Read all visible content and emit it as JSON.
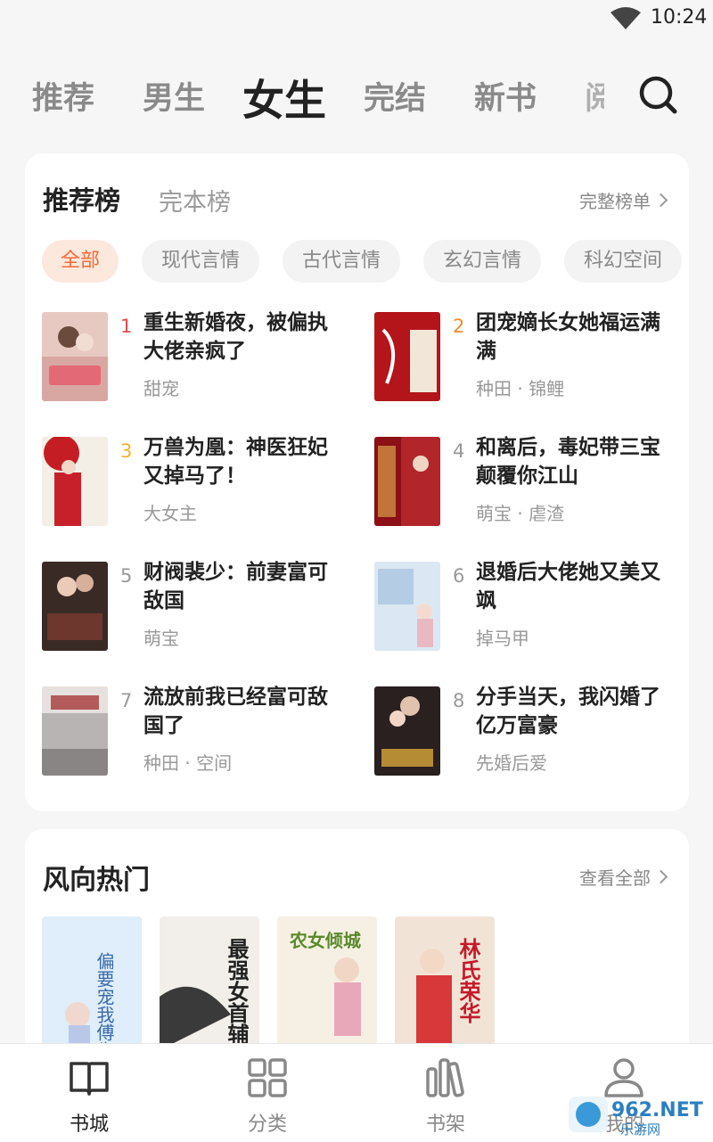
{
  "status": {
    "time": "10:24"
  },
  "top_tabs": [
    "推荐",
    "男生",
    "女生",
    "完结",
    "新书",
    "阅"
  ],
  "ranking": {
    "tabs": [
      "推荐榜",
      "完本榜"
    ],
    "more_label": "完整榜单",
    "chips": [
      "全部",
      "现代言情",
      "古代言情",
      "玄幻言情",
      "科幻空间"
    ],
    "books": [
      {
        "rank": "1",
        "title": "重生新婚夜，被偏执大佬亲疯了",
        "tags": "甜宠"
      },
      {
        "rank": "2",
        "title": "团宠嫡长女她福运满满",
        "tags": "种田 · 锦鲤"
      },
      {
        "rank": "3",
        "title": "万兽为凰：神医狂妃又掉马了！",
        "tags": "大女主"
      },
      {
        "rank": "4",
        "title": "和离后，毒妃带三宝颠覆你江山",
        "tags": "萌宝 · 虐渣"
      },
      {
        "rank": "5",
        "title": "财阀裴少：前妻富可敌国",
        "tags": "萌宝"
      },
      {
        "rank": "6",
        "title": "退婚后大佬她又美又飒",
        "tags": "掉马甲"
      },
      {
        "rank": "7",
        "title": "流放前我已经富可敌国了",
        "tags": "种田 · 空间"
      },
      {
        "rank": "8",
        "title": "分手当天，我闪婚了亿万富豪",
        "tags": "先婚后爱"
      }
    ]
  },
  "hot": {
    "title": "风向热门",
    "more_label": "查看全部",
    "covers": [
      {
        "text": "偏要宠我傅先生"
      },
      {
        "text": "最强女首辅"
      },
      {
        "text": "农女倾城"
      },
      {
        "text": "林氏荣华"
      }
    ]
  },
  "bottom_nav": [
    {
      "label": "书城",
      "icon": "book-open-icon"
    },
    {
      "label": "分类",
      "icon": "grid-icon"
    },
    {
      "label": "书架",
      "icon": "bookshelf-icon"
    },
    {
      "label": "我的",
      "icon": "user-icon"
    }
  ],
  "watermark": "962.NET 乐游网",
  "colors": {
    "accent": "#f26b34",
    "accent_bg": "#fde8de",
    "rank1": "#e84a4a",
    "rank2": "#f08c2a",
    "rank3": "#f0b22a"
  }
}
